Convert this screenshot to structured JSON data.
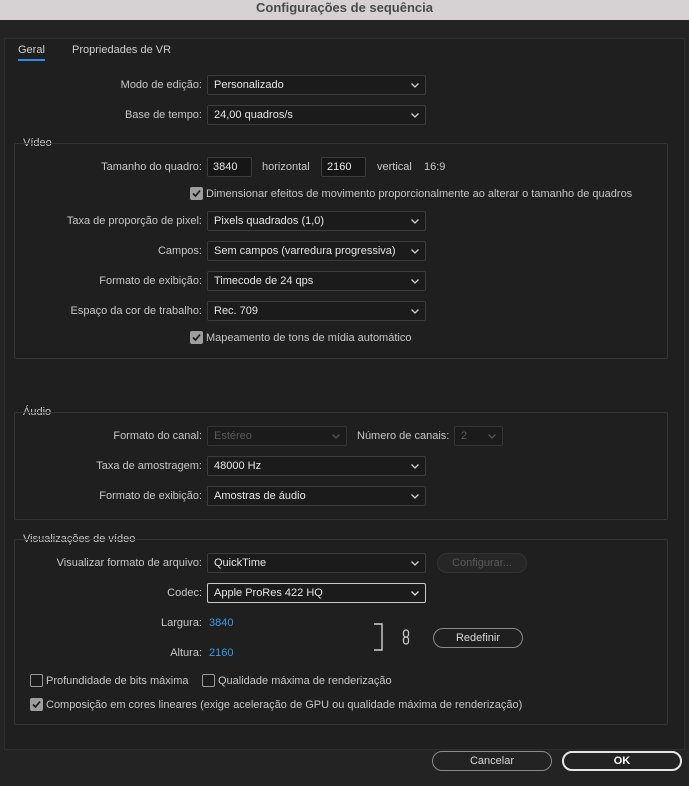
{
  "window": {
    "title": "Configurações de sequência"
  },
  "tabs": [
    {
      "label": "Geral",
      "active": true
    },
    {
      "label": "Propriedades de VR",
      "active": false
    }
  ],
  "general": {
    "edit_mode_label": "Modo de edição:",
    "edit_mode_value": "Personalizado",
    "timebase_label": "Base de tempo:",
    "timebase_value": "24,00  quadros/s"
  },
  "video": {
    "section_title": "Vídeo",
    "frame_size_label": "Tamanho do quadro:",
    "frame_width": "3840",
    "horizontal_label": "horizontal",
    "frame_height": "2160",
    "vertical_label": "vertical",
    "aspect": "16:9",
    "scale_effects_label": "Dimensionar efeitos de movimento proporcionalmente ao alterar o tamanho de quadros",
    "scale_effects_checked": true,
    "pixel_aspect_label": "Taxa de proporção de pixel:",
    "pixel_aspect_value": "Pixels quadrados (1,0)",
    "fields_label": "Campos:",
    "fields_value": "Sem campos (varredura progressiva)",
    "display_format_label": "Formato de exibição:",
    "display_format_value": "Timecode de 24 qps",
    "color_space_label": "Espaço da cor de trabalho:",
    "color_space_value": "Rec. 709",
    "tone_mapping_label": "Mapeamento de tons de mídia automático",
    "tone_mapping_checked": true
  },
  "audio": {
    "section_title": "Áudio",
    "channel_format_label": "Formato do canal:",
    "channel_format_value": "Estéreo",
    "num_channels_label": "Número de canais:",
    "num_channels_value": "2",
    "sample_rate_label": "Taxa de amostragem:",
    "sample_rate_value": "48000 Hz",
    "display_format_label": "Formato de exibição:",
    "display_format_value": "Amostras de áudio"
  },
  "previews": {
    "section_title": "Visualizações de vídeo",
    "file_format_label": "Visualizar formato de arquivo:",
    "file_format_value": "QuickTime",
    "configure_label": "Configurar...",
    "codec_label": "Codec:",
    "codec_value": "Apple ProRes 422 HQ",
    "width_label": "Largura:",
    "width_value": "3840",
    "height_label": "Altura:",
    "height_value": "2160",
    "reset_label": "Redefinir",
    "max_bit_depth_label": "Profundidade de bits máxima",
    "max_bit_depth_checked": false,
    "max_render_quality_label": "Qualidade máxima de renderização",
    "max_render_quality_checked": false,
    "linear_color_label": "Composição em cores lineares (exige aceleração de GPU ou qualidade máxima de renderização)",
    "linear_color_checked": true
  },
  "footer": {
    "cancel_label": "Cancelar",
    "ok_label": "OK"
  },
  "colors": {
    "accent": "#2d8ceb",
    "value_blue": "#3c9be8",
    "panel": "#1f1f1f",
    "titlebar": "#d6d2d4"
  }
}
